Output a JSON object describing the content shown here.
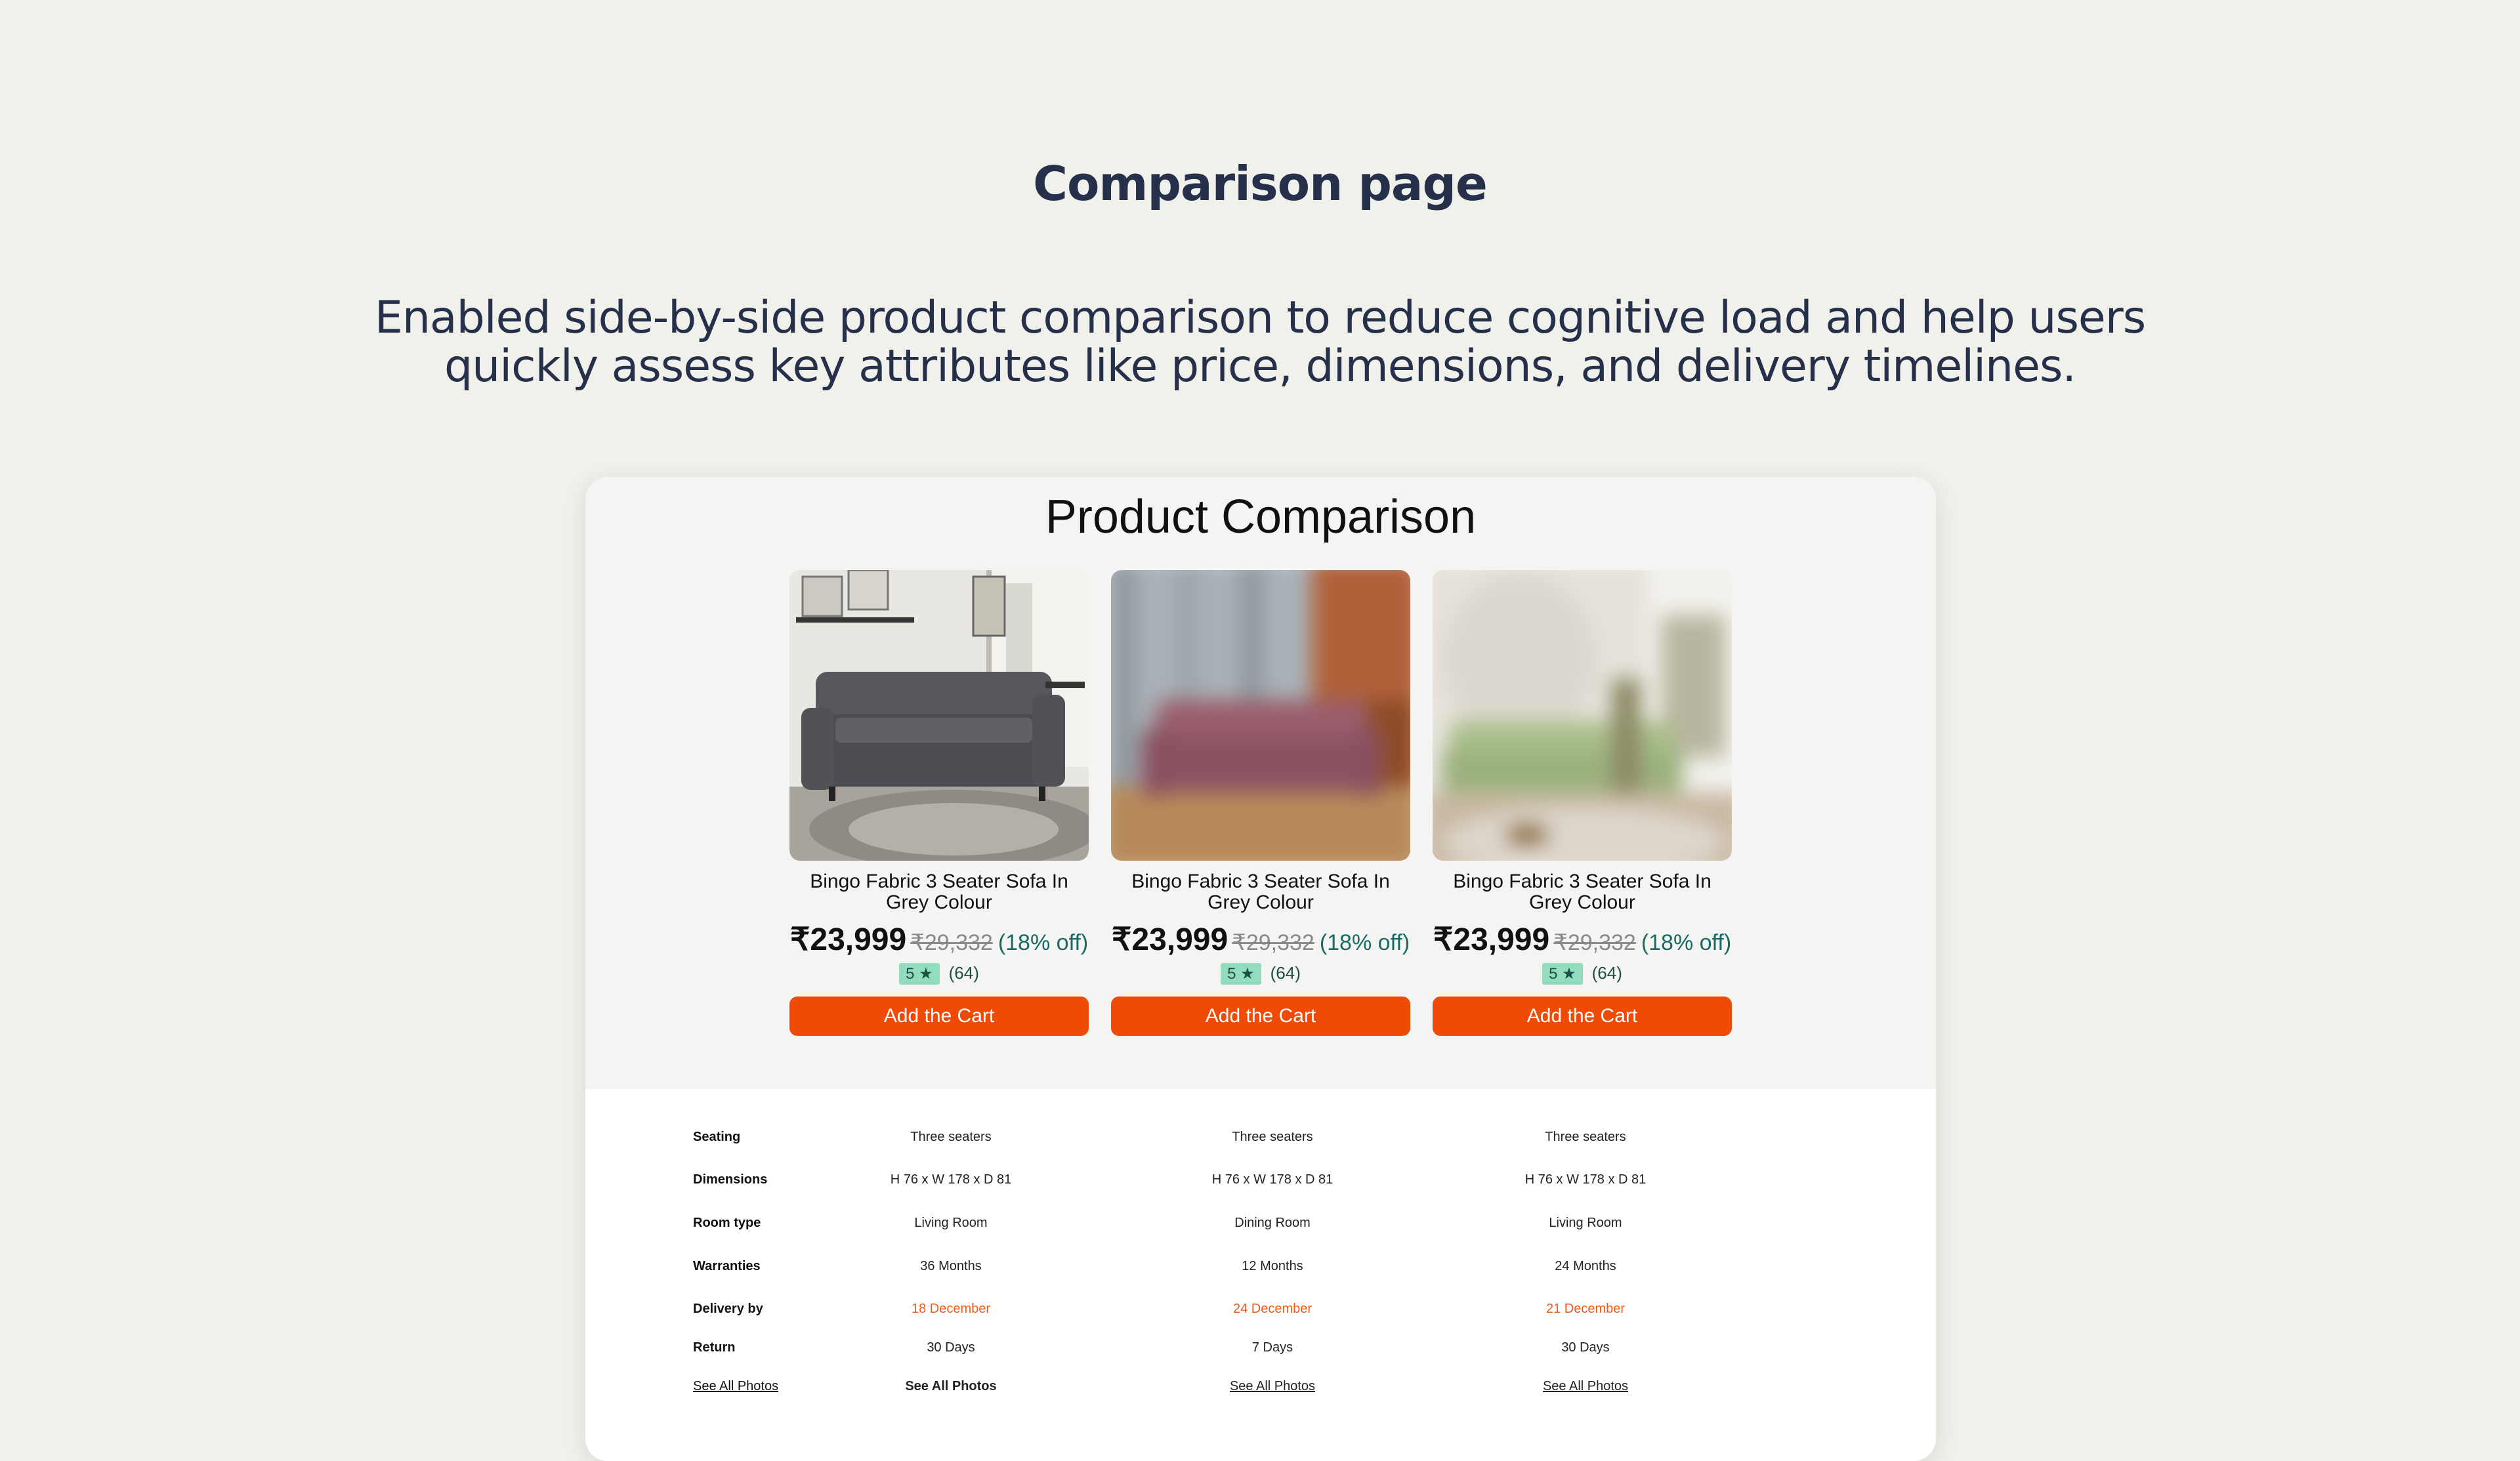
{
  "header": {
    "title": "Comparison page",
    "description": "Enabled side-by-side product comparison to reduce cognitive load and help users quickly assess key attributes like price, dimensions, and delivery timelines."
  },
  "card": {
    "title": "Product Comparison"
  },
  "products": [
    {
      "name": "Bingo Fabric 3 Seater Sofa In Grey Colour",
      "price": "₹23,999",
      "mrp": "₹29,332",
      "discount": "(18% off)",
      "rating": "5 ★",
      "reviews": "(64)",
      "cta": "Add the Cart",
      "sofa_color": "#55575c",
      "room_color": "#e9e7e2",
      "blurred": false
    },
    {
      "name": "Bingo Fabric 3 Seater Sofa In Grey Colour",
      "price": "₹23,999",
      "mrp": "₹29,332",
      "discount": "(18% off)",
      "rating": "5 ★",
      "reviews": "(64)",
      "cta": "Add the Cart",
      "sofa_color": "#9a5e6c",
      "room_color": "#c9b9a8",
      "blurred": true
    },
    {
      "name": "Bingo Fabric 3 Seater Sofa In Grey Colour",
      "price": "₹23,999",
      "mrp": "₹29,332",
      "discount": "(18% off)",
      "rating": "5 ★",
      "reviews": "(64)",
      "cta": "Add the Cart",
      "sofa_color": "#a9bf8a",
      "room_color": "#e6e2da",
      "blurred": true
    }
  ],
  "specs": [
    {
      "label": "Seating",
      "values": [
        "Three seaters",
        "Three seaters",
        "Three seaters"
      ]
    },
    {
      "label": "Dimensions",
      "values": [
        "H 76 x W 178 x D 81",
        "H 76 x W 178 x D 81",
        "H 76 x W 178 x D 81"
      ]
    },
    {
      "label": "Room type",
      "values": [
        "Living Room",
        "Dining Room",
        "Living Room"
      ]
    },
    {
      "label": "Warranties",
      "values": [
        "36 Months",
        "12 Months",
        "24 Months"
      ]
    },
    {
      "label": "Delivery by",
      "values": [
        "18 December",
        "24 December",
        "21 December"
      ]
    },
    {
      "label": "Return",
      "values": [
        "30 Days",
        "7 Days",
        "30 Days"
      ]
    },
    {
      "label": "See All Photos",
      "values": [
        "See All Photos",
        "See All Photos",
        "See All Photos"
      ]
    }
  ],
  "colors": {
    "accent": "#ef4b06",
    "discount": "#1a6b64",
    "rating_badge": "#93dcc0",
    "delivery": "#ef5b1c"
  }
}
